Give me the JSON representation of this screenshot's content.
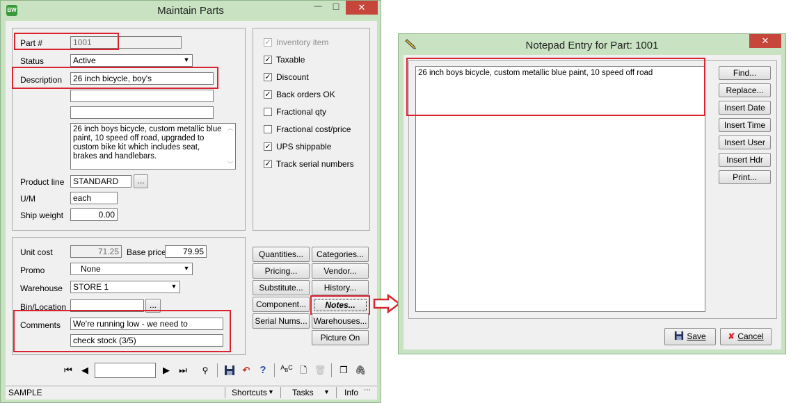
{
  "maintain": {
    "title": "Maintain Parts",
    "app_icon": "BW",
    "window_controls": {
      "minimize": "—",
      "maximize": "☐",
      "close": "✕"
    },
    "part_label": "Part #",
    "part_value": "1001",
    "status_label": "Status",
    "status_value": "Active",
    "description_label": "Description",
    "description_value": "26 inch bicycle, boy's",
    "desc2_value": "",
    "desc3_value": "",
    "long_description": "26 inch boys bicycle, custom metallic blue paint, 10 speed off road, upgraded to custom bike kit which includes seat, brakes and handlebars.",
    "product_line_label": "Product line",
    "product_line_value": "STANDARD",
    "um_label": "U/M",
    "um_value": "each",
    "ship_weight_label": "Ship weight",
    "ship_weight_value": "0.00",
    "checkboxes": [
      {
        "label": "Inventory item",
        "checked": true,
        "disabled": true
      },
      {
        "label": "Taxable",
        "checked": true,
        "disabled": false
      },
      {
        "label": "Discount",
        "checked": true,
        "disabled": false
      },
      {
        "label": "Back orders OK",
        "checked": true,
        "disabled": false
      },
      {
        "label": "Fractional qty",
        "checked": false,
        "disabled": false
      },
      {
        "label": "Fractional cost/price",
        "checked": false,
        "disabled": false
      },
      {
        "label": "UPS shippable",
        "checked": true,
        "disabled": false
      },
      {
        "label": "Track serial numbers",
        "checked": true,
        "disabled": false
      }
    ],
    "unit_cost_label": "Unit cost",
    "unit_cost_value": "71.25",
    "base_price_label": "Base price",
    "base_price_value": "79.95",
    "promo_label": "Promo",
    "promo_value": "None",
    "warehouse_label": "Warehouse",
    "warehouse_value": "STORE 1",
    "bin_label": "Bin/Location",
    "bin_value": "",
    "comments_label": "Comments",
    "comment1": "We're running low - we need to",
    "comment2": "check stock (3/5)",
    "buttons": {
      "quantities": "Quantities...",
      "categories": "Categories...",
      "pricing": "Pricing...",
      "vendor": "Vendor...",
      "substitute": "Substitute...",
      "history": "History...",
      "component": "Component...",
      "notes": "Notes...",
      "serial": "Serial Nums...",
      "warehouses": "Warehouses...",
      "picture": "Picture On"
    },
    "nav_value": "",
    "status_bar": {
      "company": "SAMPLE",
      "shortcuts": "Shortcuts",
      "tasks": "Tasks",
      "info": "Info"
    }
  },
  "notepad": {
    "title": "Notepad Entry for Part: 1001",
    "close": "✕",
    "text": "26 inch boys bicycle, custom metallic blue paint, 10 speed off road",
    "buttons": [
      "Find...",
      "Replace...",
      "Insert Date",
      "Insert Time",
      "Insert User",
      "Insert Hdr",
      "Print..."
    ],
    "save_label": "Save",
    "cancel_label": "Cancel"
  },
  "colors": {
    "window_frame": "#c9e3c2",
    "highlight": "#d9232e",
    "panel": "#f0f0f0"
  }
}
